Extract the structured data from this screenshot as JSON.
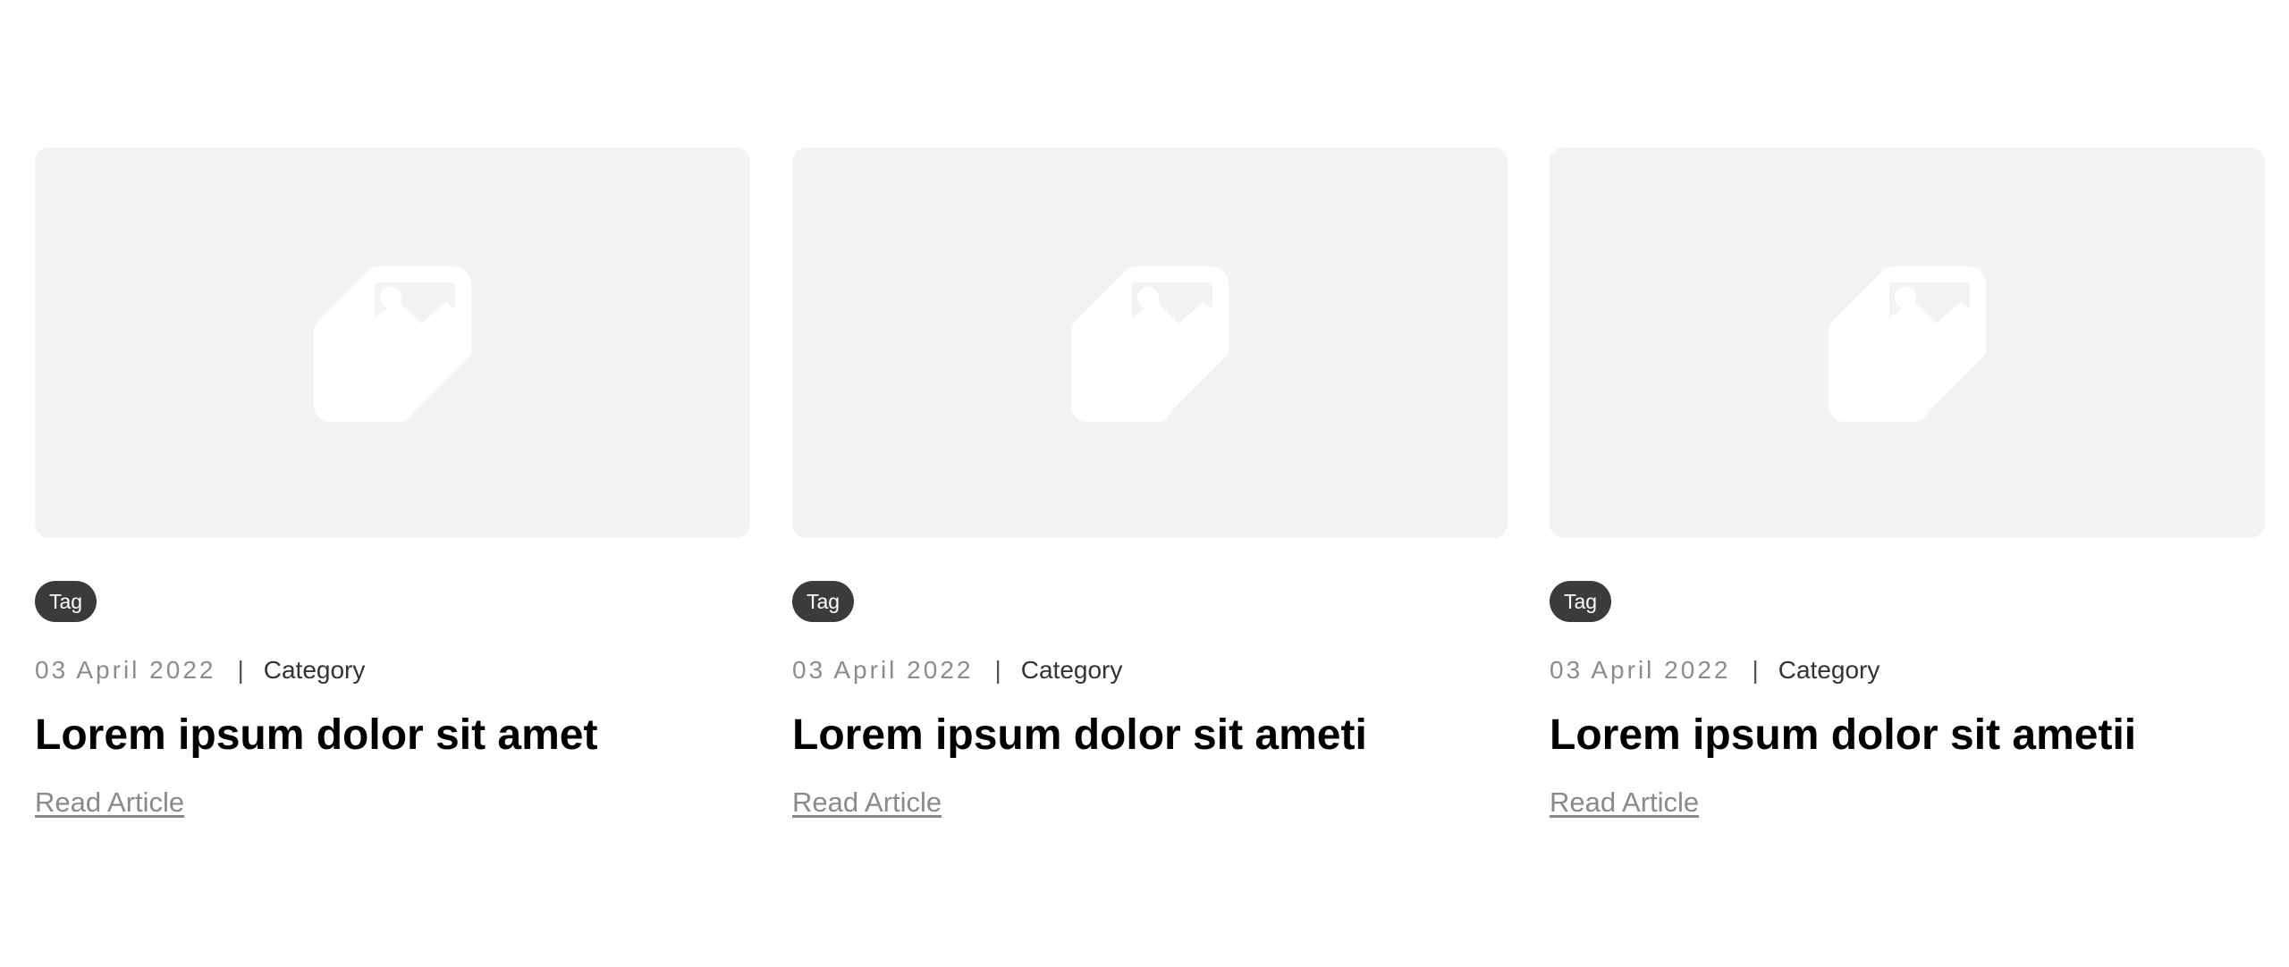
{
  "cards": [
    {
      "image_icon": "image-placeholder-icon",
      "tag": "Tag",
      "date": "03 April 2022",
      "separator": "|",
      "category": "Category",
      "title": "Lorem ipsum dolor sit amet",
      "link": "Read Article"
    },
    {
      "image_icon": "image-placeholder-icon",
      "tag": "Tag",
      "date": "03 April 2022",
      "separator": "|",
      "category": "Category",
      "title": "Lorem ipsum dolor sit ameti",
      "link": "Read Article"
    },
    {
      "image_icon": "image-placeholder-icon",
      "tag": "Tag",
      "date": "03 April 2022",
      "separator": "|",
      "category": "Category",
      "title": "Lorem ipsum dolor sit ametii",
      "link": "Read Article"
    }
  ],
  "colors": {
    "placeholder_bg": "#f3f3f3",
    "tag_bg": "#3b3b3d",
    "date_text": "#8c8c8c",
    "link_text": "#8a8a8a"
  }
}
